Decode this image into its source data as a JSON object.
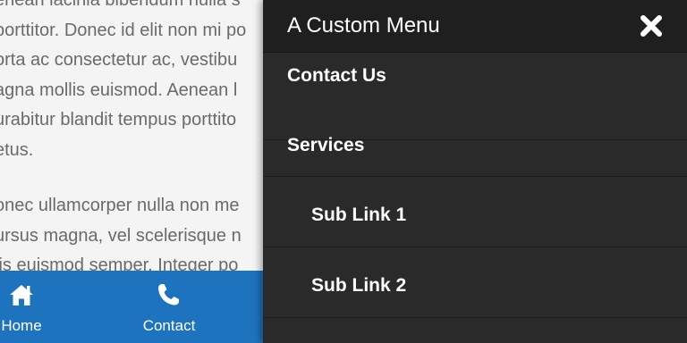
{
  "content": {
    "paragraph_1": [
      "enean lacinia bibendum nulla s",
      "porttitor. Donec id elit non mi po",
      "orta ac consectetur ac, vestibu",
      "agna mollis euismod. Aenean l",
      "urabitur blandit tempus porttito",
      "etus."
    ],
    "paragraph_2": [
      "onec ullamcorper nulla non me",
      "ursus magna, vel scelerisque n",
      "lis euismod semper. Integer po"
    ]
  },
  "bottom_nav": {
    "items": [
      {
        "label": "Home",
        "icon": "home-icon"
      },
      {
        "label": "Contact",
        "icon": "phone-icon"
      }
    ],
    "color": "#1e73be"
  },
  "menu": {
    "title": "A Custom Menu",
    "close_icon": "close-icon",
    "items": [
      {
        "label": "Contact Us",
        "level": 1
      },
      {
        "label": "Services",
        "level": 1
      },
      {
        "label": "Sub Link 1",
        "level": 2
      },
      {
        "label": "Sub Link 2",
        "level": 2
      }
    ],
    "background": "#2a2a2a"
  }
}
